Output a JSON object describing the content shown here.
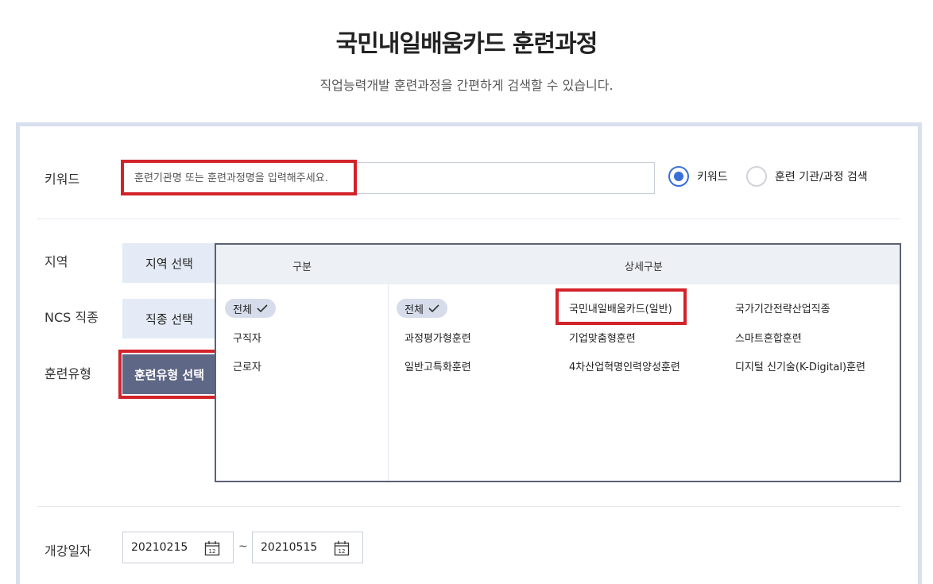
{
  "header": {
    "title": "국민내일배움카드 훈련과정",
    "subtitle": "직업능력개발 훈련과정을 간편하게 검색할 수 있습니다."
  },
  "keyword": {
    "label": "키워드",
    "placeholder": "훈련기관명 또는 훈련과정명을 입력해주세요.",
    "value": ""
  },
  "search_mode": {
    "options": [
      {
        "label": "키워드",
        "selected": true
      },
      {
        "label": "훈련 기관/과정 검색",
        "selected": false
      }
    ]
  },
  "filters": {
    "region_label": "지역",
    "region_button": "지역 선택",
    "ncs_label": "NCS 직종",
    "ncs_button": "직종 선택",
    "type_label": "훈련유형",
    "type_button": "훈련유형 선택"
  },
  "type_table": {
    "col_category": "구분",
    "col_detail": "상세구분",
    "categories": [
      {
        "label": "전체",
        "selected": true
      },
      {
        "label": "구직자",
        "selected": false
      },
      {
        "label": "근로자",
        "selected": false
      }
    ],
    "details": [
      {
        "label": "전체",
        "selected": true
      },
      {
        "label": "국민내일배움카드(일반)",
        "selected": false
      },
      {
        "label": "국가기간전략산업직종",
        "selected": false
      },
      {
        "label": "과정평가형훈련",
        "selected": false
      },
      {
        "label": "기업맞춤형훈련",
        "selected": false
      },
      {
        "label": "스마트혼합훈련",
        "selected": false
      },
      {
        "label": "일반고특화훈련",
        "selected": false
      },
      {
        "label": "4차산업혁명인력양성훈련",
        "selected": false
      },
      {
        "label": "디지털 신기술(K-Digital)훈련",
        "selected": false
      }
    ]
  },
  "start_date": {
    "label": "개강일자",
    "from": "20210215",
    "separator": "~",
    "to": "20210515",
    "calendar_day": "12"
  },
  "colors": {
    "accent": "#3b6fd8",
    "active_button": "#5f6786",
    "highlight": "#d2232a",
    "panel_border": "#d8dfee"
  }
}
